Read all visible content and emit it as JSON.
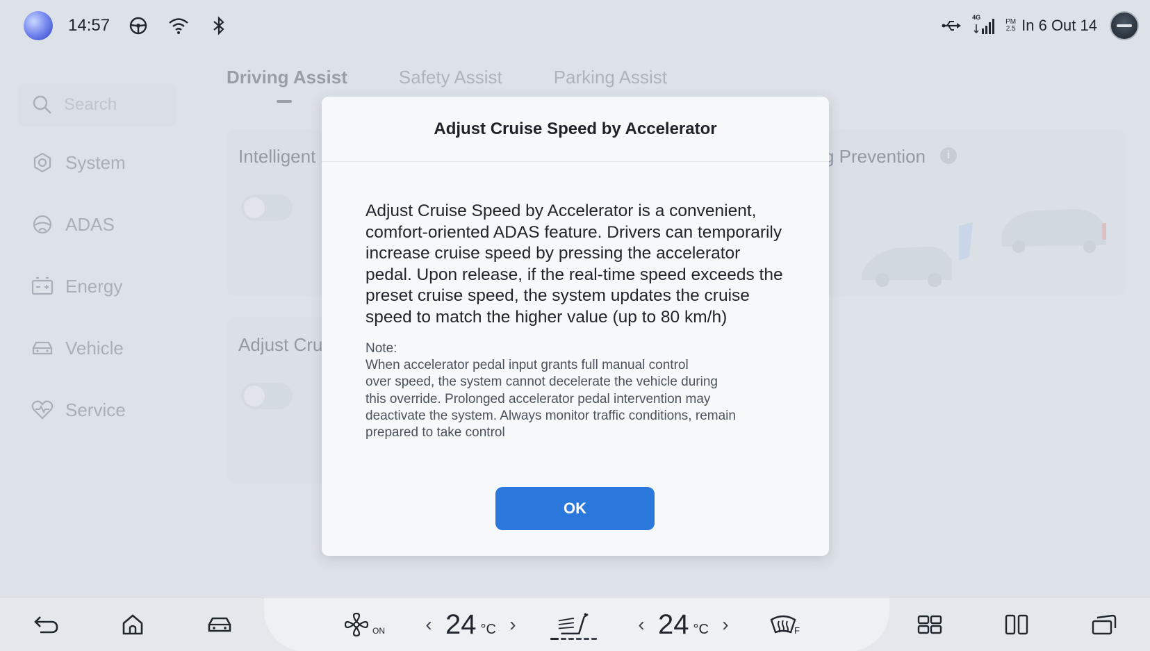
{
  "status_bar": {
    "time": "14:57",
    "icons": [
      "assistant-logo",
      "steering-wheel-icon",
      "wifi-icon",
      "bluetooth-icon",
      "usb-icon",
      "cellular-4g-icon",
      "avatar"
    ],
    "network_label": "4G",
    "pm_label": "PM",
    "pm_value": "2.5",
    "air_quality": "In 6  Out 14"
  },
  "sidebar": {
    "search_placeholder": "Search",
    "items": [
      {
        "label": "System",
        "icon": "settings-hex-icon"
      },
      {
        "label": "ADAS",
        "icon": "steering-icon"
      },
      {
        "label": "Energy",
        "icon": "battery-icon"
      },
      {
        "label": "Vehicle",
        "icon": "car-icon"
      },
      {
        "label": "Service",
        "icon": "heart-pulse-icon"
      }
    ]
  },
  "tabs": [
    {
      "label": "Driving Assist",
      "active": true
    },
    {
      "label": "Safety Assist",
      "active": false
    },
    {
      "label": "Parking Assist",
      "active": false
    }
  ],
  "background_cards": {
    "card1_title": "Intelligent",
    "card2_title": "Adjust Cru",
    "card3_title": "g Prevention",
    "info_glyph": "i"
  },
  "dialog": {
    "title": "Adjust Cruise Speed by Accelerator",
    "body": "Adjust Cruise Speed by Accelerator is a convenient, comfort-oriented ADAS feature. Drivers can temporarily increase cruise speed by pressing the accelerator pedal. Upon release, if the real-time speed exceeds the preset cruise speed, the system updates the cruise speed to match the higher value (up to 80 km/h)",
    "note_label": "Note:",
    "note_lines": [
      "When accelerator pedal input grants full manual control",
      "over speed, the system cannot decelerate the vehicle during",
      "this override. Prolonged accelerator pedal intervention may",
      "deactivate the system. Always monitor traffic conditions, remain",
      "prepared to take control"
    ],
    "ok_label": "OK"
  },
  "dock": {
    "fan_label": "ON",
    "left_temp": "24",
    "right_temp": "24",
    "temp_unit": "°C",
    "defrost_label": "F",
    "left_arrow": "‹",
    "right_arrow": "›"
  },
  "colors": {
    "accent": "#2b78dc",
    "background": "#dde2e8",
    "dialog_bg": "#f7f8fa",
    "text_primary": "#1f242b"
  }
}
